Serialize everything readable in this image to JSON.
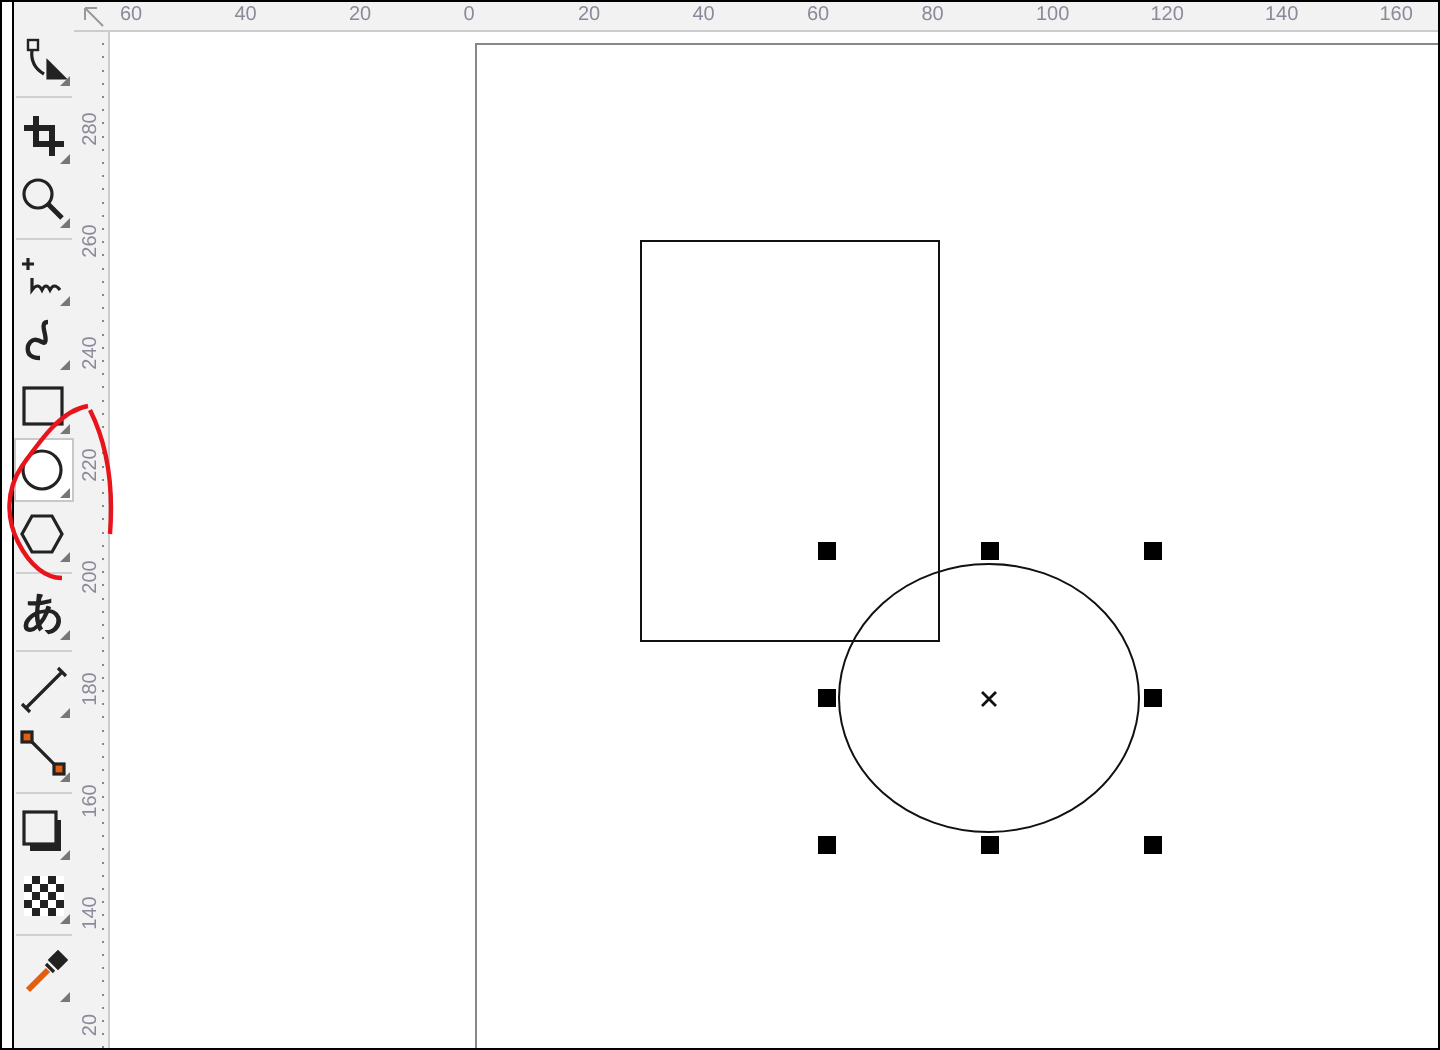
{
  "toolbox": {
    "groups": [
      [
        {
          "kind": "shape-edit",
          "selected": false
        }
      ],
      [
        {
          "kind": "crop",
          "selected": false
        },
        {
          "kind": "zoom",
          "selected": false
        }
      ],
      [
        {
          "kind": "freehand",
          "selected": false
        },
        {
          "kind": "artistic",
          "selected": false
        },
        {
          "kind": "rectangle",
          "selected": false
        },
        {
          "kind": "ellipse",
          "selected": true
        },
        {
          "kind": "polygon",
          "selected": false
        }
      ],
      [
        {
          "kind": "text",
          "glyph": "あ",
          "selected": false
        }
      ],
      [
        {
          "kind": "dimension",
          "selected": false
        },
        {
          "kind": "connector",
          "selected": false
        }
      ],
      [
        {
          "kind": "shadow",
          "selected": false
        },
        {
          "kind": "transparency",
          "selected": false
        }
      ],
      [
        {
          "kind": "eyedropper",
          "selected": false
        }
      ]
    ]
  },
  "horizontal_ruler": {
    "labels": [
      "60",
      "40",
      "20",
      "0",
      "20",
      "40",
      "60",
      "80",
      "100",
      "120",
      "140",
      "160"
    ]
  },
  "vertical_ruler": {
    "labels": [
      "280",
      "260",
      "240",
      "220",
      "200",
      "180",
      "160",
      "140",
      "20"
    ]
  },
  "canvas": {
    "objects": [
      {
        "kind": "rectangle",
        "selected": false
      },
      {
        "kind": "ellipse",
        "selected": true
      }
    ]
  }
}
